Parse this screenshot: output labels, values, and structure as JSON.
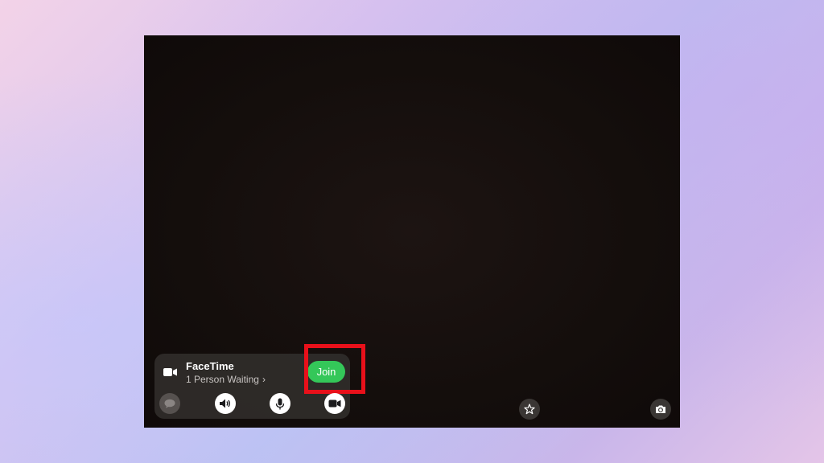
{
  "notification": {
    "app_name": "FaceTime",
    "status": "1 Person Waiting",
    "chevron": "›",
    "join_label": "Join"
  },
  "controls": [
    {
      "name": "message-icon"
    },
    {
      "name": "speaker-icon"
    },
    {
      "name": "microphone-icon"
    },
    {
      "name": "video-camera-icon"
    }
  ],
  "camera_controls": [
    {
      "name": "effects-star-icon"
    },
    {
      "name": "camera-flip-icon"
    }
  ],
  "colors": {
    "join_green": "#34c759",
    "highlight_red": "#e8101a",
    "screen_bg": "#140e0c"
  }
}
